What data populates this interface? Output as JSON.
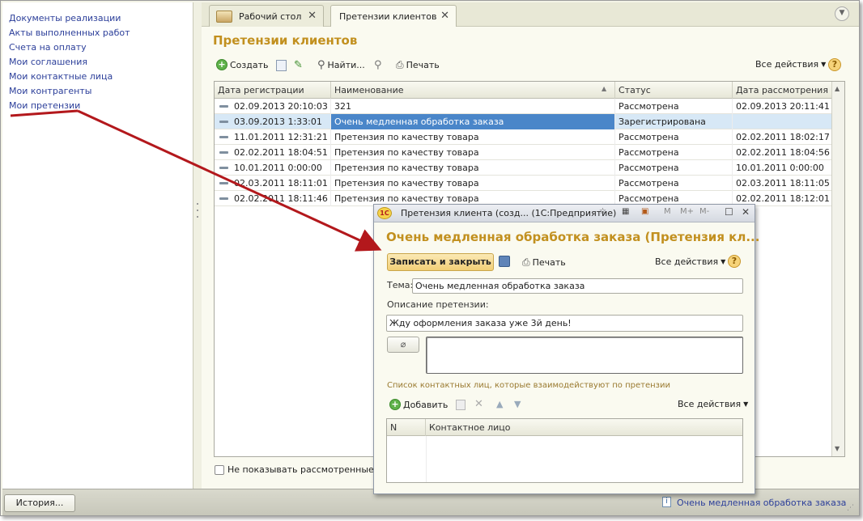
{
  "sidebar": {
    "items": [
      {
        "label": "Документы реализации"
      },
      {
        "label": "Акты выполненных работ"
      },
      {
        "label": "Счета на оплату"
      },
      {
        "label": "Мои соглашения"
      },
      {
        "label": "Мои контактные лица"
      },
      {
        "label": "Мои контрагенты"
      },
      {
        "label": "Мои претензии"
      }
    ]
  },
  "tabs": [
    {
      "label": "Рабочий стол"
    },
    {
      "label": "Претензии клиентов"
    }
  ],
  "main": {
    "title": "Претензии клиентов",
    "toolbar": {
      "create": "Создать",
      "find": "Найти...",
      "print": "Печать",
      "all_actions": "Все действия",
      "help": "?"
    },
    "table": {
      "columns": [
        "Дата регистрации",
        "Наименование",
        "Статус",
        "Дата рассмотрения"
      ],
      "rows": [
        {
          "date": "02.09.2013 20:10:03",
          "name": "321",
          "status": "Рассмотрена",
          "reviewed": "02.09.2013 20:11:41"
        },
        {
          "date": "03.09.2013 1:33:01",
          "name": "Очень медленная обработка заказа",
          "status": "Зарегистрирована",
          "reviewed": ""
        },
        {
          "date": "11.01.2011 12:31:21",
          "name": "Претензия по качеству товара",
          "status": "Рассмотрена",
          "reviewed": "02.02.2011 18:02:17"
        },
        {
          "date": "02.02.2011 18:04:51",
          "name": "Претензия по качеству товара",
          "status": "Рассмотрена",
          "reviewed": "02.02.2011 18:04:56"
        },
        {
          "date": "10.01.2011 0:00:00",
          "name": "Претензия по качеству товара",
          "status": "Рассмотрена",
          "reviewed": "10.01.2011 0:00:00"
        },
        {
          "date": "02.03.2011 18:11:01",
          "name": "Претензия по качеству товара",
          "status": "Рассмотрена",
          "reviewed": "02.03.2011 18:11:05"
        },
        {
          "date": "02.02.2011 18:11:46",
          "name": "Претензия по качеству товара",
          "status": "Рассмотрена",
          "reviewed": "02.02.2011 18:12:01"
        }
      ]
    },
    "hide_reviewed_label": "Не показывать рассмотренные"
  },
  "dialog": {
    "window_title": "Претензия клиента (созд... (1С:Предприятие)",
    "app_icon": "1С",
    "header": "Очень медленная обработка заказа (Претензия кл...",
    "save_close": "Записать и закрыть",
    "print": "Печать",
    "all_actions": "Все действия",
    "help": "?",
    "topic_label": "Тема:",
    "topic_value": "Очень медленная обработка заказа",
    "description_label": "Описание претензии:",
    "description_value": "Жду оформления заказа уже 3й день!",
    "contacts_section": "Список контактных лиц, которые взаимодействуют по претензии",
    "add": "Добавить",
    "contacts_all_actions": "Все действия",
    "contacts_columns": [
      "N",
      "Контактное лицо"
    ],
    "titlebar_buttons": [
      "M",
      "M+",
      "M-"
    ]
  },
  "status": {
    "history": "История...",
    "message": "Очень медленная обработка заказа"
  },
  "colors": {
    "title_gold": "#c2901f",
    "link_blue": "#2c3f9a",
    "selected_row": "#d7e8f6",
    "arrow_red": "#b3181c"
  }
}
